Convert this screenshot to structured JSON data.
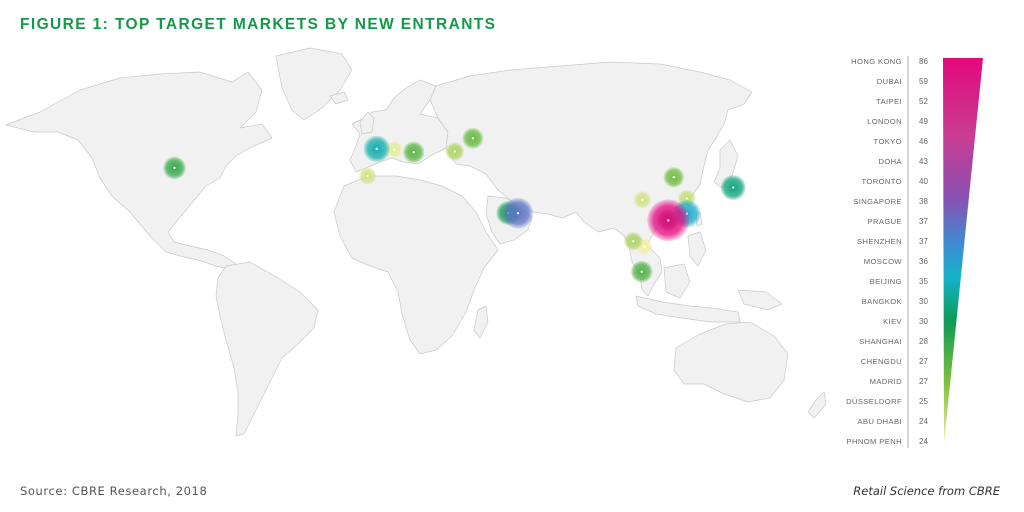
{
  "title": "FIGURE 1: TOP TARGET MARKETS BY NEW ENTRANTS",
  "source": "Source: CBRE Research, 2018",
  "brand": "Retail Science from CBRE",
  "colors": {
    "title": "#139a48",
    "scale": [
      "#f5f0a0",
      "#7ec13b",
      "#0e9a57",
      "#14b3c9",
      "#3f8ad2",
      "#8a4fb0",
      "#c93c92",
      "#e3097f"
    ]
  },
  "chart_data": {
    "type": "bubble-map",
    "categories": [
      "HONG KONG",
      "DUBAI",
      "TAIPEI",
      "LONDON",
      "TOKYO",
      "DOHA",
      "TORONTO",
      "SINGAPORE",
      "PRAGUE",
      "SHENZHEN",
      "MOSCOW",
      "BEIJING",
      "BANGKOK",
      "KIEV",
      "SHANGHAI",
      "CHENGDU",
      "MADRID",
      "DÜSSELDORF",
      "ABU DHABI",
      "PHNOM PENH"
    ],
    "values": [
      86,
      59,
      52,
      49,
      46,
      43,
      40,
      38,
      37,
      37,
      36,
      35,
      30,
      30,
      28,
      27,
      27,
      25,
      24,
      24
    ],
    "value_range": [
      24,
      86
    ]
  }
}
